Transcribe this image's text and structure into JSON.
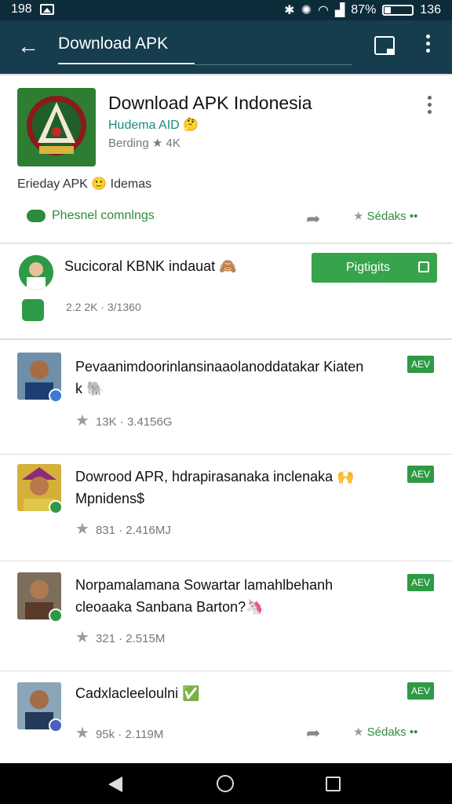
{
  "status": {
    "time_left": "198",
    "battery_text": "87%",
    "time_right": "136"
  },
  "app_bar": {
    "title": "Download APK"
  },
  "app": {
    "name": "Download APK Indonesia",
    "developer": "Hudema AID 🤔",
    "rating": "Berding ★ 4K",
    "meta": "Erieday APK   🙂 Idemas",
    "share_label": "Phesnel comnlngs",
    "right_label": "Sédaks ••"
  },
  "post": {
    "title": "Sucicoral KBNK indauat 🙈",
    "button_label": "Pigtigits",
    "meta": "2.2 2K · 3/1360"
  },
  "comments": [
    {
      "text_line1": "Pevaanimdoorinlansinaaolanoddatakar Kiaten",
      "text_line2": "k 🐘",
      "tag": "AEV",
      "meta": "13K · 3.4156G"
    },
    {
      "text_line1": "Dowrood APR, hdrapirasanaka inclenaka 🙌",
      "text_line2": "Mpnidens$",
      "tag": "AEV",
      "meta": "831 · 2.416MJ"
    },
    {
      "text_line1": "Norpamalamana Sowartar lamahlbehanh",
      "text_line2": "cleoaaka Sanbana Barton?🦄",
      "tag": "AEV",
      "meta": "321 · 2.515M"
    },
    {
      "text_line1": "Cadxlacleeloulni ✅",
      "text_line2": "",
      "tag": "AEV",
      "meta": "95k · 2.119M",
      "share_right": "Sédaks ••"
    }
  ],
  "colors": {
    "app_bar": "#163d4d",
    "status_bar": "#0d2c3a",
    "accent_green": "#37a34a",
    "link_green": "#2e8b3a"
  }
}
